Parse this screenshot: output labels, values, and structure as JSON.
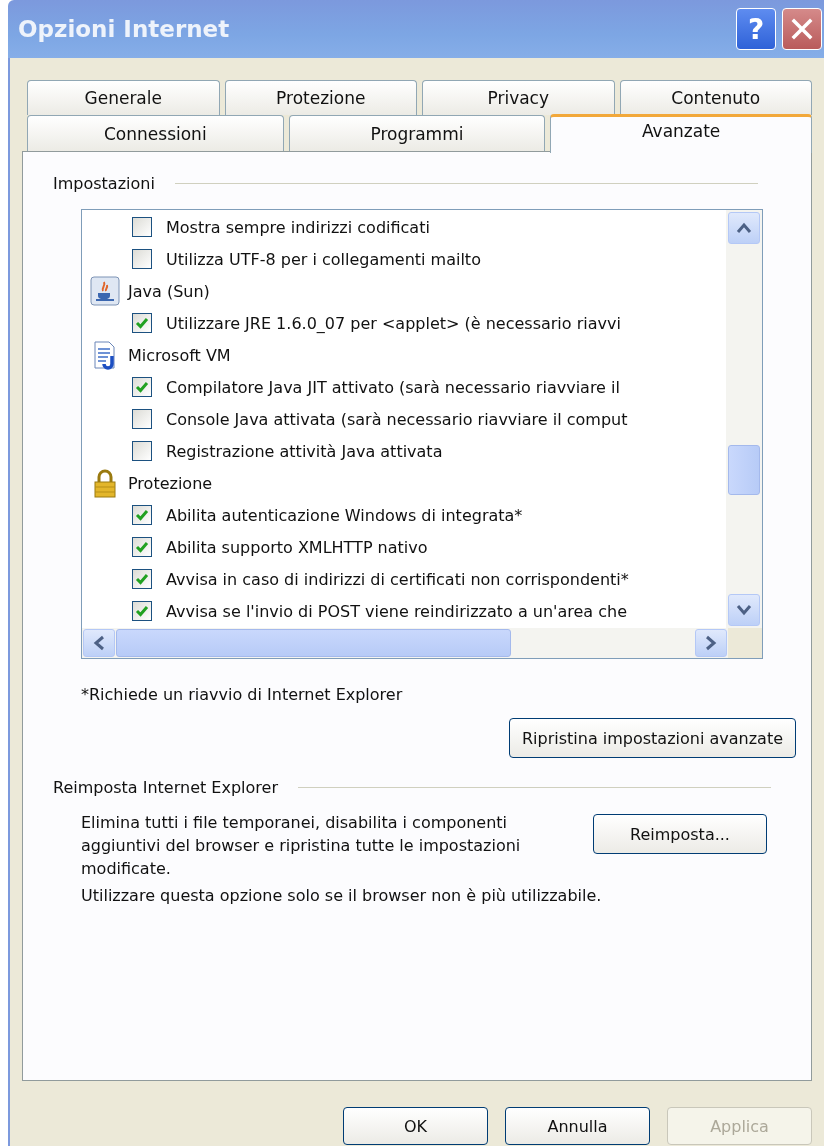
{
  "window": {
    "title": "Opzioni Internet",
    "help_button": "?"
  },
  "tab_rows": [
    [
      {
        "label": "Generale",
        "selected": false
      },
      {
        "label": "Protezione",
        "selected": false
      },
      {
        "label": "Privacy",
        "selected": false
      },
      {
        "label": "Contenuto",
        "selected": false
      }
    ],
    [
      {
        "label": "Connessioni",
        "selected": false
      },
      {
        "label": "Programmi",
        "selected": false
      },
      {
        "label": "Avanzate",
        "selected": true
      }
    ]
  ],
  "settings": {
    "title": "Impostazioni",
    "items": [
      {
        "kind": "option",
        "label": "Mostra sempre indirizzi codificati",
        "checked": false
      },
      {
        "kind": "option",
        "label": "Utilizza UTF-8 per i collegamenti mailto",
        "checked": false
      },
      {
        "kind": "group",
        "label": "Java (Sun)"
      },
      {
        "kind": "option",
        "label": "Utilizzare JRE 1.6.0_07 per <applet> (è necessario riavvi",
        "checked": true
      },
      {
        "kind": "group",
        "label": "Microsoft VM"
      },
      {
        "kind": "option",
        "label": "Compilatore Java JIT attivato (sarà necessario riavviare il",
        "checked": true
      },
      {
        "kind": "option",
        "label": "Console Java attivata (sarà necessario riavviare il comput",
        "checked": false
      },
      {
        "kind": "option",
        "label": "Registrazione attività Java attivata",
        "checked": false
      },
      {
        "kind": "group",
        "label": "Protezione"
      },
      {
        "kind": "option",
        "label": "Abilita autenticazione Windows di integrata*",
        "checked": true
      },
      {
        "kind": "option",
        "label": "Abilita supporto XMLHTTP nativo",
        "checked": true
      },
      {
        "kind": "option",
        "label": "Avvisa in caso di indirizzi di certificati non corrispondenti*",
        "checked": true
      },
      {
        "kind": "option",
        "label": "Avvisa se l'invio di POST viene reindirizzato a un'area che",
        "checked": true
      }
    ],
    "footnote": "*Richiede un riavvio di Internet Explorer",
    "restore_button": "Ripristina impostazioni avanzate"
  },
  "reset": {
    "title": "Reimposta Internet Explorer",
    "description": "Elimina tutti i file temporanei, disabilita i componenti aggiuntivi del browser e ripristina tutte le impostazioni modificate.",
    "button": "Reimposta...",
    "note": "Utilizzare questa opzione solo se il browser non è più utilizzabile."
  },
  "buttons": [
    {
      "label": "OK",
      "disabled": false
    },
    {
      "label": "Annulla",
      "disabled": false
    },
    {
      "label": "Applica",
      "disabled": true
    }
  ]
}
